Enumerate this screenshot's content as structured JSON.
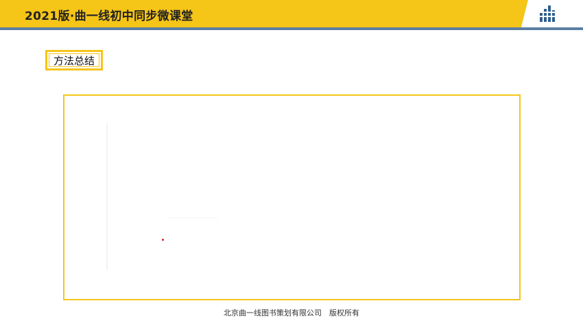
{
  "header": {
    "title": "2021版·曲一线初中同步微课堂",
    "logo_icon": "bar-chart-logo-icon"
  },
  "section": {
    "label": "方法总结"
  },
  "footer": {
    "copyright": "北京曲一线图书策划有限公司　版权所有"
  },
  "colors": {
    "header_yellow": "#f5c518",
    "header_rule": "#5b7fa3",
    "frame_border": "#f5c518",
    "logo_blue": "#2f5e8c",
    "pointer_red": "#d81e2c"
  }
}
